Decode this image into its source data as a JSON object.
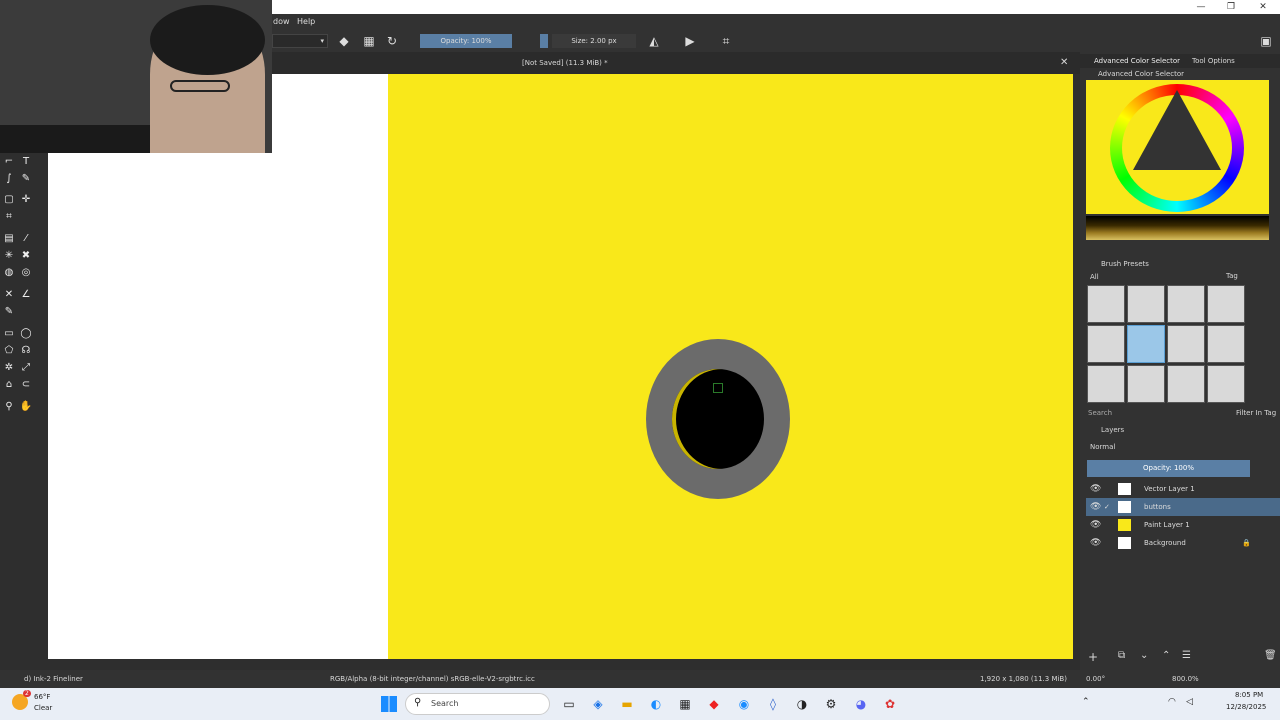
{
  "window": {
    "minimize": "—",
    "maximize": "❐",
    "close": "✕"
  },
  "menu": [
    "dow",
    "Help"
  ],
  "toolbar": {
    "opacity": "Opacity: 100%",
    "size": "Size: 2.00 px"
  },
  "document": {
    "title": "[Not Saved]  (11.3 MiB) *",
    "close": "✕"
  },
  "color_panel": {
    "tabs": [
      "Advanced Color Selector",
      "Tool Options"
    ],
    "title": "Advanced Color Selector"
  },
  "brush_presets": {
    "title": "Brush Presets",
    "filter": "All",
    "tag": "Tag",
    "search_placeholder": "Search",
    "filter_in_tag": "Filter In Tag"
  },
  "layers": {
    "title": "Layers",
    "blend_mode": "Normal",
    "opacity": "Opacity:  100%",
    "items": [
      {
        "name": "Vector Layer 1",
        "selected": false
      },
      {
        "name": "buttons",
        "selected": true
      },
      {
        "name": "Paint Layer 1",
        "selected": false
      },
      {
        "name": "Background",
        "selected": false
      }
    ]
  },
  "status": {
    "brush": "d) Ink-2 Fineliner",
    "color_space": "RGB/Alpha (8-bit integer/channel)  sRGB-elle-V2-srgbtrc.icc",
    "dimensions": "1,920 x 1,080 (11.3 MiB)",
    "rotation": "0.00°",
    "zoom": "800.0%"
  },
  "taskbar": {
    "weather_temp": "66°F",
    "weather_desc": "Clear",
    "weather_badge": "2",
    "search": "Search",
    "time": "8:05 PM",
    "date": "12/28/2025"
  },
  "colors": {
    "canvas_yellow": "#f9e81a",
    "selected_layer": "#4a6a8a",
    "opacity_bar": "#5a7fa5"
  }
}
